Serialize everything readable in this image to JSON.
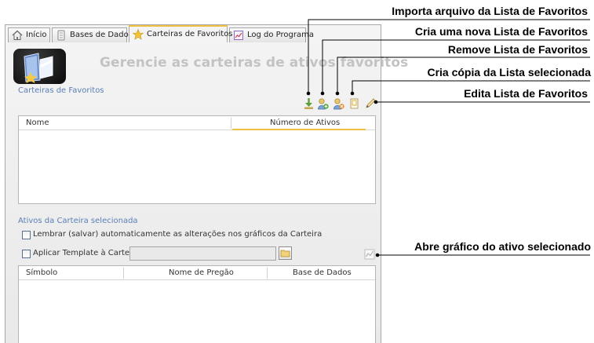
{
  "tabs": [
    {
      "label": "Início",
      "icon": "home-icon",
      "active": false
    },
    {
      "label": "Bases de Dados",
      "icon": "database-icon",
      "active": false
    },
    {
      "label": "Carteiras de Favoritos",
      "icon": "star-icon",
      "active": true
    },
    {
      "label": "Log do Programa",
      "icon": "log-icon",
      "active": false
    }
  ],
  "header": {
    "title": "Gerencie as carteiras de ativos favoritos"
  },
  "favorites": {
    "section_label": "Carteiras de Favoritos",
    "columns": [
      "Nome",
      "Número de Ativos"
    ],
    "rows": []
  },
  "assets": {
    "section_label": "Ativos da Carteira selecionada",
    "remember_label": "Lembrar (salvar) automaticamente as alterações nos gráficos da Carteira",
    "remember_checked": false,
    "template_label": "Aplicar Template à Carteira",
    "template_checked": false,
    "template_value": "",
    "columns": [
      "Símbolo",
      "Nome de Pregão",
      "Base de Dados"
    ],
    "rows": []
  },
  "callouts": {
    "import": "Importa arquivo da Lista de Favoritos",
    "create": "Cria uma nova Lista de Favoritos",
    "remove": "Remove Lista de Favoritos",
    "copy": "Cria cópia da Lista selecionada",
    "edit": "Edita Lista de Favoritos",
    "chart": "Abre gráfico do ativo selecionado"
  },
  "colors": {
    "section_label": "#5a7fb5",
    "title": "#c3c3c3",
    "active_tab_underline": "#f0c040"
  }
}
